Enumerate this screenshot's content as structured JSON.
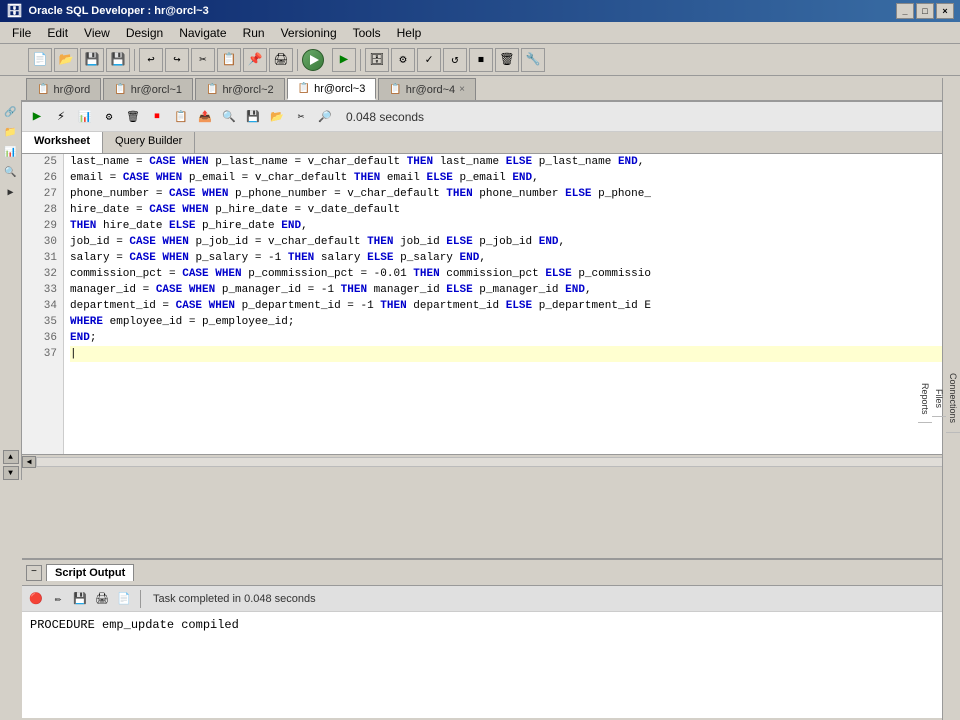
{
  "titleBar": {
    "icon": "🗄",
    "title": "Oracle SQL Developer : hr@orcl~3",
    "controls": [
      "_",
      "□",
      "×"
    ]
  },
  "menuBar": {
    "items": [
      "File",
      "Edit",
      "View",
      "Design",
      "Navigate",
      "Run",
      "Versioning",
      "Tools",
      "Help"
    ]
  },
  "tabs": [
    {
      "id": "tab1",
      "icon": "📋",
      "label": "hr@ord",
      "active": false,
      "closable": false
    },
    {
      "id": "tab2",
      "icon": "📋",
      "label": "hr@orcl~1",
      "active": false,
      "closable": false
    },
    {
      "id": "tab3",
      "icon": "📋",
      "label": "hr@orcl~2",
      "active": false,
      "closable": false
    },
    {
      "id": "tab4",
      "icon": "📋",
      "label": "hr@orcl~3",
      "active": true,
      "closable": false
    },
    {
      "id": "tab5",
      "icon": "📋",
      "label": "hr@ord~4",
      "active": false,
      "closable": true
    }
  ],
  "worksheetToolbar": {
    "timer": "0.048 seconds",
    "buttons": [
      "▶",
      "⚡",
      "⟳",
      "⏹",
      "📋",
      "🔍",
      "⚙",
      "📥",
      "📤",
      "💾",
      "✂",
      "📌",
      "⚠"
    ]
  },
  "subTabs": {
    "items": [
      "Worksheet",
      "Query Builder"
    ],
    "active": "Worksheet"
  },
  "codeLines": [
    {
      "num": 25,
      "content": [
        {
          "type": "plain",
          "text": "    last_name = "
        },
        {
          "type": "kw",
          "text": "CASE WHEN"
        },
        {
          "type": "plain",
          "text": " p_last_name = v_char_default "
        },
        {
          "type": "kw",
          "text": "THEN"
        },
        {
          "type": "plain",
          "text": " last_name "
        },
        {
          "type": "kw",
          "text": "ELSE"
        },
        {
          "type": "plain",
          "text": " p_last_name "
        },
        {
          "type": "kw",
          "text": "END"
        },
        {
          "type": "plain",
          "text": ","
        }
      ]
    },
    {
      "num": 26,
      "content": [
        {
          "type": "plain",
          "text": "    email = "
        },
        {
          "type": "kw",
          "text": "CASE WHEN"
        },
        {
          "type": "plain",
          "text": " p_email = v_char_default "
        },
        {
          "type": "kw",
          "text": "THEN"
        },
        {
          "type": "plain",
          "text": " email "
        },
        {
          "type": "kw",
          "text": "ELSE"
        },
        {
          "type": "plain",
          "text": " p_email "
        },
        {
          "type": "kw",
          "text": "END"
        },
        {
          "type": "plain",
          "text": ","
        }
      ]
    },
    {
      "num": 27,
      "content": [
        {
          "type": "plain",
          "text": "    phone_number = "
        },
        {
          "type": "kw",
          "text": "CASE WHEN"
        },
        {
          "type": "plain",
          "text": " p_phone_number = v_char_default "
        },
        {
          "type": "kw",
          "text": "THEN"
        },
        {
          "type": "plain",
          "text": " phone_number "
        },
        {
          "type": "kw",
          "text": "ELSE"
        },
        {
          "type": "plain",
          "text": " p_phone_"
        }
      ]
    },
    {
      "num": 28,
      "content": [
        {
          "type": "plain",
          "text": "    hire_date = "
        },
        {
          "type": "kw",
          "text": "CASE WHEN"
        },
        {
          "type": "plain",
          "text": " p_hire_date = v_date_default"
        }
      ]
    },
    {
      "num": 29,
      "content": [
        {
          "type": "plain",
          "text": "        "
        },
        {
          "type": "kw",
          "text": "THEN"
        },
        {
          "type": "plain",
          "text": " hire_date "
        },
        {
          "type": "kw",
          "text": "ELSE"
        },
        {
          "type": "plain",
          "text": " p_hire_date "
        },
        {
          "type": "kw",
          "text": "END"
        },
        {
          "type": "plain",
          "text": ","
        }
      ]
    },
    {
      "num": 30,
      "content": [
        {
          "type": "plain",
          "text": "    job_id = "
        },
        {
          "type": "kw",
          "text": "CASE WHEN"
        },
        {
          "type": "plain",
          "text": " p_job_id = v_char_default "
        },
        {
          "type": "kw",
          "text": "THEN"
        },
        {
          "type": "plain",
          "text": " job_id "
        },
        {
          "type": "kw",
          "text": "ELSE"
        },
        {
          "type": "plain",
          "text": " p_job_id "
        },
        {
          "type": "kw",
          "text": "END"
        },
        {
          "type": "plain",
          "text": ","
        }
      ]
    },
    {
      "num": 31,
      "content": [
        {
          "type": "plain",
          "text": "    salary = "
        },
        {
          "type": "kw",
          "text": "CASE WHEN"
        },
        {
          "type": "plain",
          "text": " p_salary = -1 "
        },
        {
          "type": "kw",
          "text": "THEN"
        },
        {
          "type": "plain",
          "text": " salary "
        },
        {
          "type": "kw",
          "text": "ELSE"
        },
        {
          "type": "plain",
          "text": " p_salary "
        },
        {
          "type": "kw",
          "text": "END"
        },
        {
          "type": "plain",
          "text": ","
        }
      ]
    },
    {
      "num": 32,
      "content": [
        {
          "type": "plain",
          "text": "    commission_pct = "
        },
        {
          "type": "kw",
          "text": "CASE WHEN"
        },
        {
          "type": "plain",
          "text": " p_commission_pct = -0.01 "
        },
        {
          "type": "kw",
          "text": "THEN"
        },
        {
          "type": "plain",
          "text": " commission_pct "
        },
        {
          "type": "kw",
          "text": "ELSE"
        },
        {
          "type": "plain",
          "text": " p_commissio"
        }
      ]
    },
    {
      "num": 33,
      "content": [
        {
          "type": "plain",
          "text": "    manager_id = "
        },
        {
          "type": "kw",
          "text": "CASE WHEN"
        },
        {
          "type": "plain",
          "text": " p_manager_id = -1 "
        },
        {
          "type": "kw",
          "text": "THEN"
        },
        {
          "type": "plain",
          "text": " manager_id "
        },
        {
          "type": "kw",
          "text": "ELSE"
        },
        {
          "type": "plain",
          "text": " p_manager_id "
        },
        {
          "type": "kw",
          "text": "END"
        },
        {
          "type": "plain",
          "text": ","
        }
      ]
    },
    {
      "num": 34,
      "content": [
        {
          "type": "plain",
          "text": "    department_id = "
        },
        {
          "type": "kw",
          "text": "CASE WHEN"
        },
        {
          "type": "plain",
          "text": " p_department_id = -1 "
        },
        {
          "type": "kw",
          "text": "THEN"
        },
        {
          "type": "plain",
          "text": " department_id "
        },
        {
          "type": "kw",
          "text": "ELSE"
        },
        {
          "type": "plain",
          "text": " p_department_id E"
        }
      ]
    },
    {
      "num": 35,
      "content": [
        {
          "type": "plain",
          "text": "  "
        },
        {
          "type": "kw",
          "text": "WHERE"
        },
        {
          "type": "plain",
          "text": " employee_id = p_employee_id;"
        }
      ]
    },
    {
      "num": 36,
      "content": [
        {
          "type": "kw",
          "text": "END"
        },
        {
          "type": "plain",
          "text": ";"
        }
      ]
    },
    {
      "num": 37,
      "content": [],
      "cursor": true
    }
  ],
  "scriptOutput": {
    "tabLabel": "Script Output",
    "statusText": "Task completed in 0.048 seconds",
    "outputText": "PROCEDURE emp_update compiled"
  },
  "rightSidebar": {
    "items": [
      "Conn...",
      "Files",
      "Reports"
    ]
  }
}
